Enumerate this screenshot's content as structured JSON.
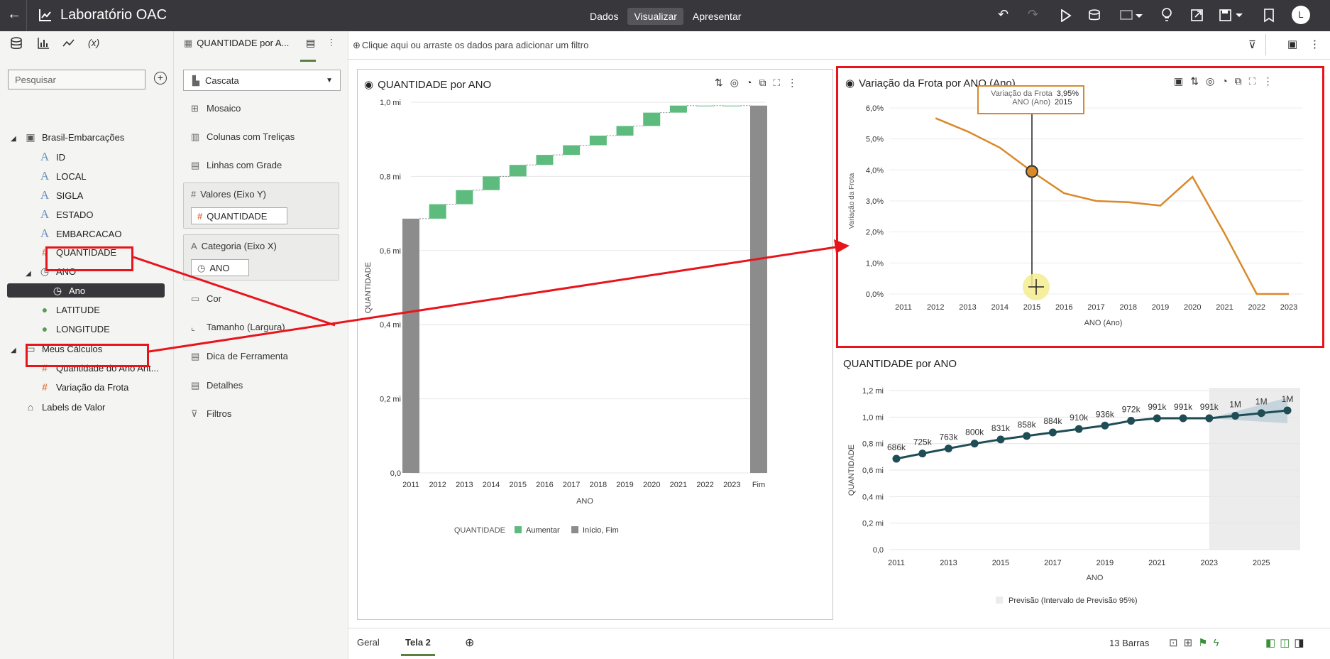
{
  "app": {
    "title": "Laboratório OAC"
  },
  "modes": [
    "Dados",
    "Visualizar",
    "Apresentar"
  ],
  "active_mode": "Visualizar",
  "user_initial": "L",
  "left_panel": {
    "tabs": [
      "data-icon",
      "chart-icon",
      "trend-icon",
      "(x)"
    ],
    "search_placeholder": "Pesquisar",
    "tree": [
      {
        "label": "Brasil-Embarcações",
        "type": "dataset"
      },
      {
        "label": "ID",
        "type": "text"
      },
      {
        "label": "LOCAL",
        "type": "text"
      },
      {
        "label": "SIGLA",
        "type": "text"
      },
      {
        "label": "ESTADO",
        "type": "text"
      },
      {
        "label": "EMBARCACAO",
        "type": "text"
      },
      {
        "label": "QUANTIDADE",
        "type": "number"
      },
      {
        "label": "ANO",
        "type": "time"
      },
      {
        "label": "Ano",
        "type": "time"
      },
      {
        "label": "LATITUDE",
        "type": "geo"
      },
      {
        "label": "LONGITUDE",
        "type": "geo"
      },
      {
        "label": "Meus Cálculos",
        "type": "folder"
      },
      {
        "label": "Quantidade do Ano Ant...",
        "type": "number"
      },
      {
        "label": "Variação da Frota",
        "type": "number"
      },
      {
        "label": "Labels de Valor",
        "type": "tag"
      }
    ]
  },
  "grammar_panel": {
    "header": "QUANTIDADE por A...",
    "chart_type": "Cascata",
    "items": [
      "Mosaico",
      "Colunas com Treliças",
      "Linhas com Grade"
    ],
    "values_slot": {
      "label": "Valores (Eixo Y)",
      "chip": "QUANTIDADE"
    },
    "category_slot": {
      "label": "Categoria (Eixo X)",
      "chip": "ANO"
    },
    "items2": [
      "Cor",
      "Tamanho (Largura)",
      "Dica de Ferramenta",
      "Detalhes",
      "Filtros"
    ]
  },
  "filter_bar": {
    "hint": "Clique aqui ou arraste os dados para adicionar um filtro"
  },
  "bottom": {
    "tabs": [
      "Geral",
      "Tela 2"
    ],
    "active_tab": "Tela 2",
    "status": "13 Barras"
  },
  "tooltip": {
    "label1": "Variação da Frota",
    "value1": "3,95%",
    "label2": "ANO (Ano)",
    "value2": "2015"
  },
  "chart_data": [
    {
      "type": "bar",
      "subtype": "waterfall",
      "title": "QUANTIDADE por ANO",
      "xlabel": "ANO",
      "ylabel": "QUANTIDADE",
      "categories": [
        "2011",
        "2012",
        "2013",
        "2014",
        "2015",
        "2016",
        "2017",
        "2018",
        "2019",
        "2020",
        "2021",
        "2022",
        "2023",
        "Fim"
      ],
      "values": [
        686,
        39,
        38,
        37,
        31,
        27,
        26,
        26,
        26,
        36,
        19,
        0,
        0,
        991
      ],
      "value_unit": "mil",
      "cumulative": [
        686,
        725,
        763,
        800,
        831,
        858,
        884,
        910,
        936,
        972,
        991,
        991,
        991,
        991
      ],
      "yticks": [
        "0,0",
        "0,2 mi",
        "0,4 mi",
        "0,6 mi",
        "0,8 mi",
        "1,0 mi"
      ],
      "ylim": [
        0,
        1000
      ],
      "legend": {
        "title": "QUANTIDADE",
        "items": [
          {
            "name": "Aumentar",
            "color": "#5dbb7e"
          },
          {
            "name": "Início, Fim",
            "color": "#8c8c8c"
          }
        ]
      }
    },
    {
      "type": "line",
      "title": "Variação da Frota por ANO (Ano)",
      "xlabel": "ANO (Ano)",
      "ylabel": "Variação da Frota",
      "x": [
        "2012",
        "2013",
        "2014",
        "2015",
        "2016",
        "2017",
        "2018",
        "2019",
        "2020",
        "2021",
        "2022",
        "2023"
      ],
      "xticks": [
        "2011",
        "2012",
        "2013",
        "2014",
        "2015",
        "2016",
        "2017",
        "2018",
        "2019",
        "2020",
        "2021",
        "2022",
        "2023"
      ],
      "values": [
        5.67,
        5.24,
        4.72,
        3.95,
        3.25,
        3.0,
        2.96,
        2.85,
        3.78,
        1.95,
        0.0,
        0.0
      ],
      "yticks": [
        "0,0%",
        "1,0%",
        "2,0%",
        "3,0%",
        "4,0%",
        "5,0%",
        "6,0%"
      ],
      "ylim": [
        0,
        6
      ],
      "color": "#d9892a"
    },
    {
      "type": "line",
      "title": "QUANTIDADE por ANO",
      "xlabel": "ANO",
      "ylabel": "QUANTIDADE",
      "x": [
        2011,
        2012,
        2013,
        2014,
        2015,
        2016,
        2017,
        2018,
        2019,
        2020,
        2021,
        2022,
        2023,
        2024,
        2025,
        2026
      ],
      "values": [
        686,
        725,
        763,
        800,
        831,
        858,
        884,
        910,
        936,
        972,
        991,
        991,
        991,
        1010,
        1030,
        1050
      ],
      "labels": [
        "686k",
        "725k",
        "763k",
        "800k",
        "831k",
        "858k",
        "884k",
        "910k",
        "936k",
        "972k",
        "991k",
        "991k",
        "991k",
        "1M",
        "1M",
        "1M"
      ],
      "xticks": [
        "2011",
        "2013",
        "2015",
        "2017",
        "2019",
        "2021",
        "2023",
        "2025"
      ],
      "yticks": [
        "0,0",
        "0,2 mi",
        "0,4 mi",
        "0,6 mi",
        "0,8 mi",
        "1,0 mi",
        "1,2 mi"
      ],
      "ylim": [
        0,
        1200
      ],
      "color": "#1e4d55",
      "forecast_from": 2023,
      "legend": "Previsão (Intervalo de Previsão 95%)"
    }
  ]
}
